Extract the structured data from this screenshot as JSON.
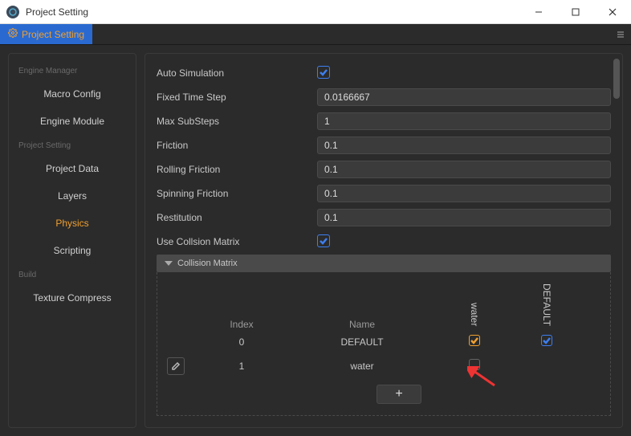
{
  "window": {
    "title": "Project Setting"
  },
  "tab": {
    "label": "Project Setting"
  },
  "sidebar": {
    "sections": [
      {
        "title": "Engine Manager",
        "items": [
          {
            "label": "Macro Config",
            "selected": false
          },
          {
            "label": "Engine Module",
            "selected": false
          }
        ]
      },
      {
        "title": "Project Setting",
        "items": [
          {
            "label": "Project Data",
            "selected": false
          },
          {
            "label": "Layers",
            "selected": false
          },
          {
            "label": "Physics",
            "selected": true
          },
          {
            "label": "Scripting",
            "selected": false
          }
        ]
      },
      {
        "title": "Build",
        "items": [
          {
            "label": "Texture Compress",
            "selected": false
          }
        ]
      }
    ]
  },
  "form": {
    "autoSimulation": {
      "label": "Auto Simulation",
      "checked": true
    },
    "fixedTimeStep": {
      "label": "Fixed Time Step",
      "value": "0.0166667"
    },
    "maxSubSteps": {
      "label": "Max SubSteps",
      "value": "1"
    },
    "friction": {
      "label": "Friction",
      "value": "0.1"
    },
    "rollingFriction": {
      "label": "Rolling Friction",
      "value": "0.1"
    },
    "spinningFriction": {
      "label": "Spinning Friction",
      "value": "0.1"
    },
    "restitution": {
      "label": "Restitution",
      "value": "0.1"
    },
    "useCollisionMatrix": {
      "label": "Use Collsion Matrix",
      "checked": true
    }
  },
  "matrix": {
    "title": "Collision Matrix",
    "headers": {
      "index": "Index",
      "name": "Name"
    },
    "columns": [
      "water",
      "DEFAULT"
    ],
    "rows": [
      {
        "index": "0",
        "name": "DEFAULT",
        "editable": false,
        "cells": [
          {
            "checked": true,
            "style": "gold"
          },
          {
            "checked": true,
            "style": "blue"
          }
        ]
      },
      {
        "index": "1",
        "name": "water",
        "editable": true,
        "cells": [
          {
            "checked": false,
            "style": "grey"
          }
        ]
      }
    ],
    "addLabel": "+"
  }
}
